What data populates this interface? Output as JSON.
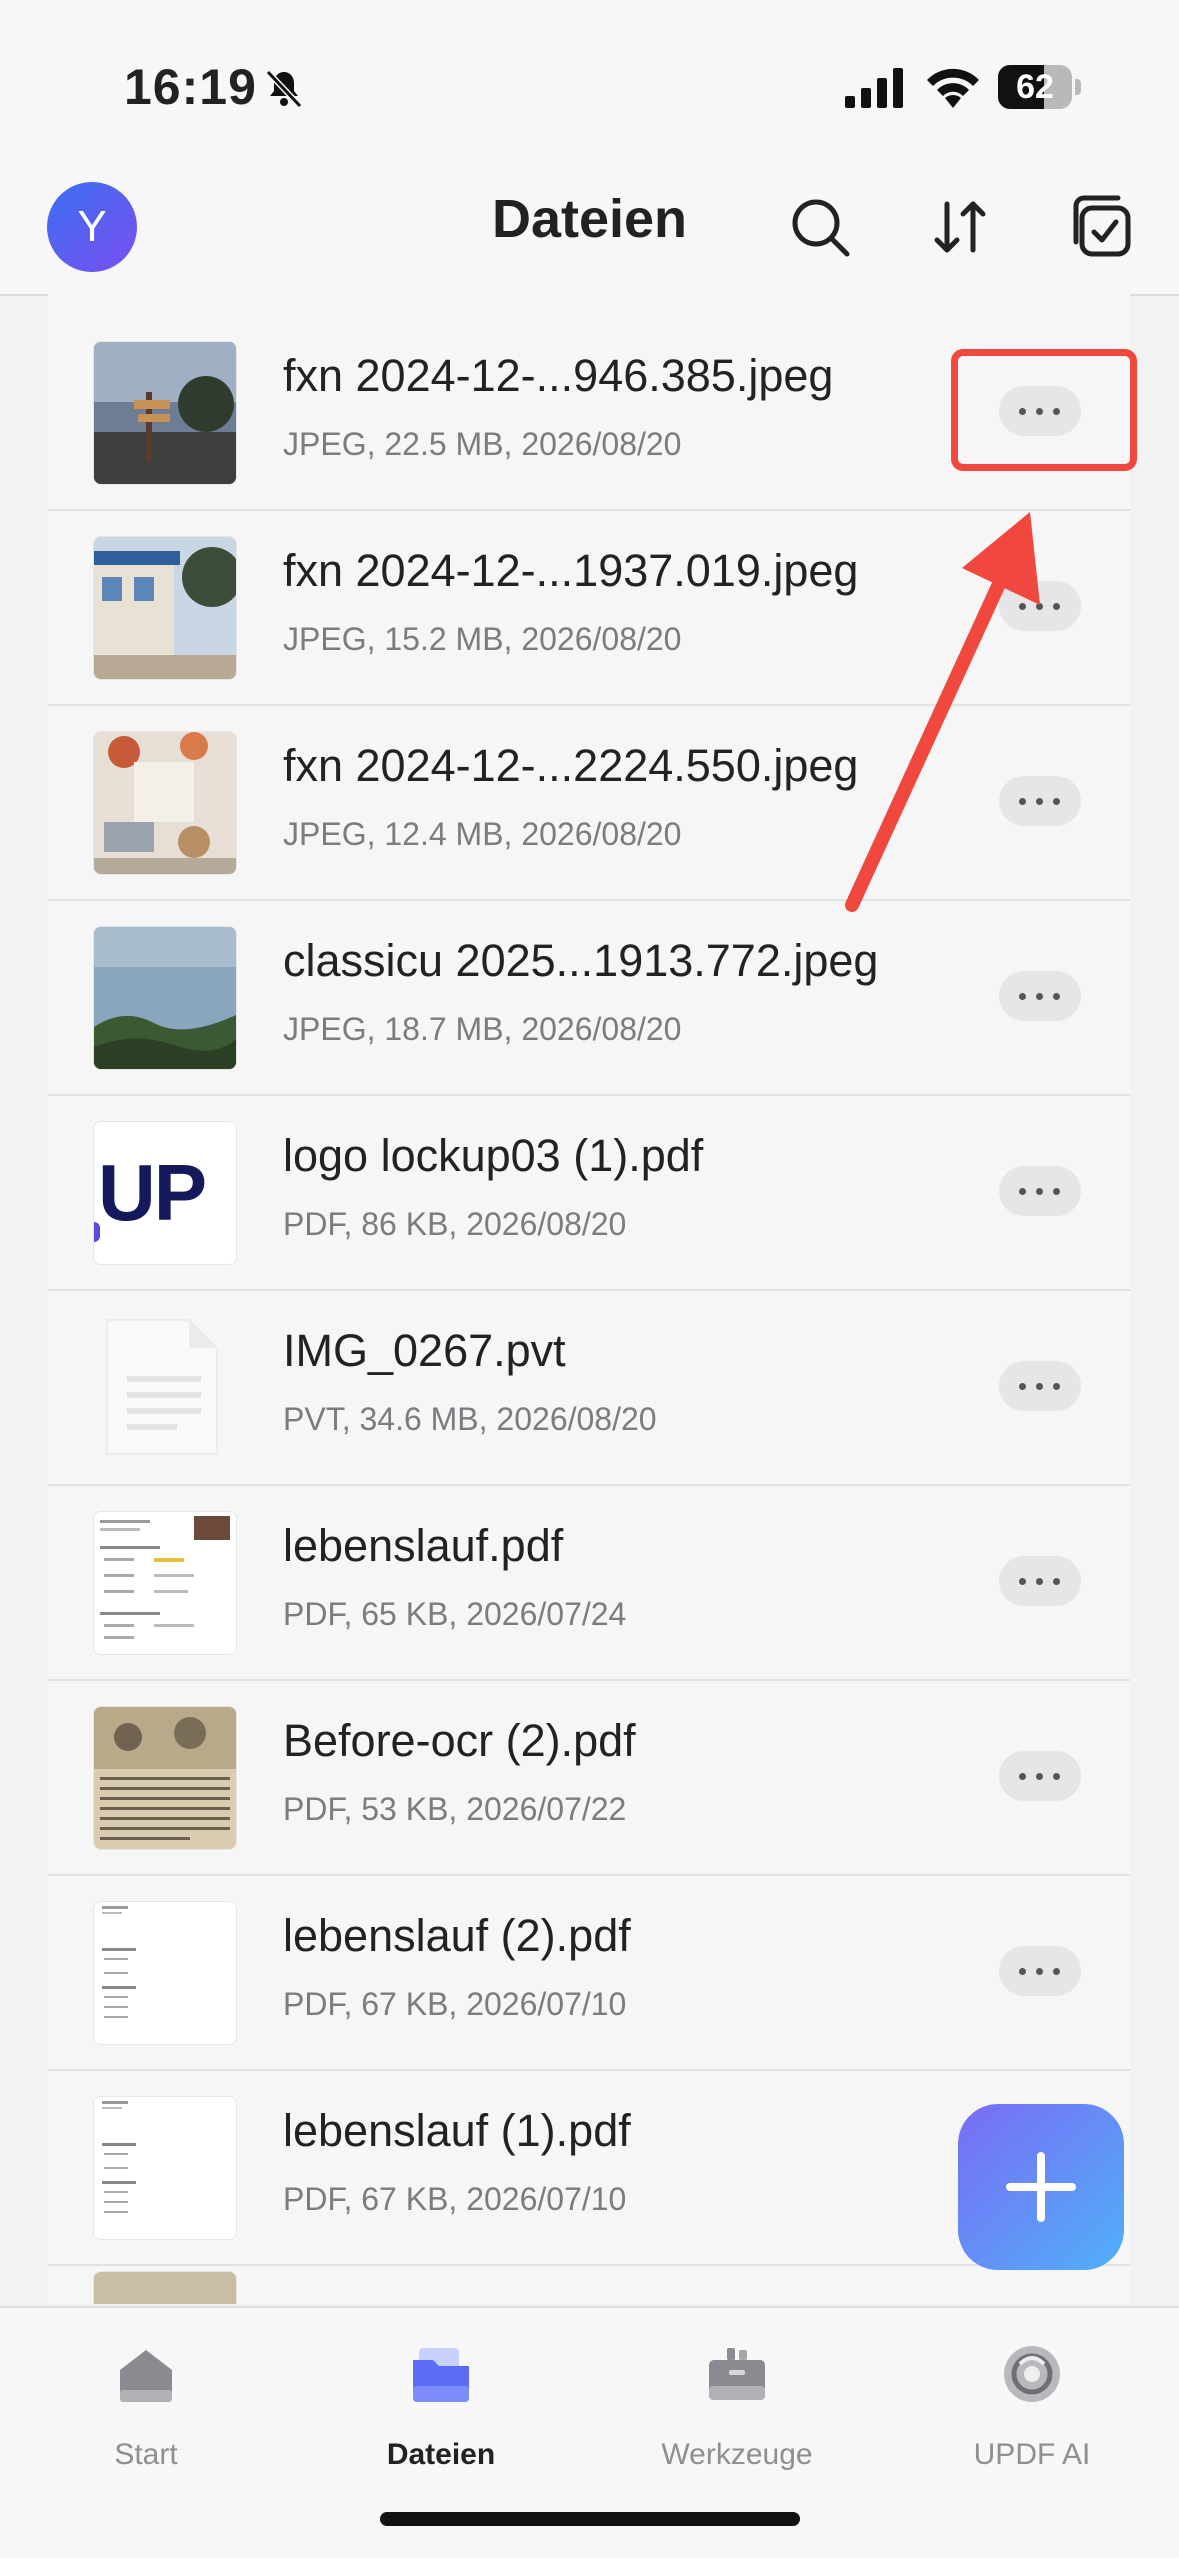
{
  "status": {
    "time": "16:19",
    "battery": "62",
    "battery_level": 0.62
  },
  "header": {
    "avatar_letter": "Y",
    "title": "Dateien"
  },
  "files": [
    {
      "name": "fxn 2024-12-...946.385.jpeg",
      "meta": "JPEG, 22.5 MB, 2026/08/20",
      "thumb": "photo-sign"
    },
    {
      "name": "fxn 2024-12-...1937.019.jpeg",
      "meta": "JPEG, 15.2 MB, 2026/08/20",
      "thumb": "photo-house"
    },
    {
      "name": "fxn 2024-12-...2224.550.jpeg",
      "meta": "JPEG, 12.4 MB, 2026/08/20",
      "thumb": "photo-shop"
    },
    {
      "name": "classicu 2025...1913.772.jpeg",
      "meta": "JPEG, 18.7 MB, 2026/08/20",
      "thumb": "photo-sea"
    },
    {
      "name": "logo lockup03 (1).pdf",
      "meta": "PDF, 86 KB, 2026/08/20",
      "thumb": "logo",
      "thumb_text": "UP"
    },
    {
      "name": "IMG_0267.pvt",
      "meta": "PVT, 34.6 MB, 2026/08/20",
      "thumb": "generic-file"
    },
    {
      "name": "lebenslauf.pdf",
      "meta": "PDF, 65 KB, 2026/07/24",
      "thumb": "document"
    },
    {
      "name": "Before-ocr (2).pdf",
      "meta": "PDF, 53 KB, 2026/07/22",
      "thumb": "old-newspaper"
    },
    {
      "name": "lebenslauf (2).pdf",
      "meta": "PDF, 67 KB, 2026/07/10",
      "thumb": "document-plain"
    },
    {
      "name": "lebenslauf (1).pdf",
      "meta": "PDF, 67 KB, 2026/07/10",
      "thumb": "document-plain"
    }
  ],
  "tabs": [
    {
      "label": "Start",
      "icon": "home-icon"
    },
    {
      "label": "Dateien",
      "icon": "folder-icon",
      "active": true
    },
    {
      "label": "Werkzeuge",
      "icon": "toolbox-icon"
    },
    {
      "label": "UPDF AI",
      "icon": "ai-icon"
    }
  ],
  "colors": {
    "accent": "#5b6cf6",
    "highlight": "#f0473f"
  }
}
